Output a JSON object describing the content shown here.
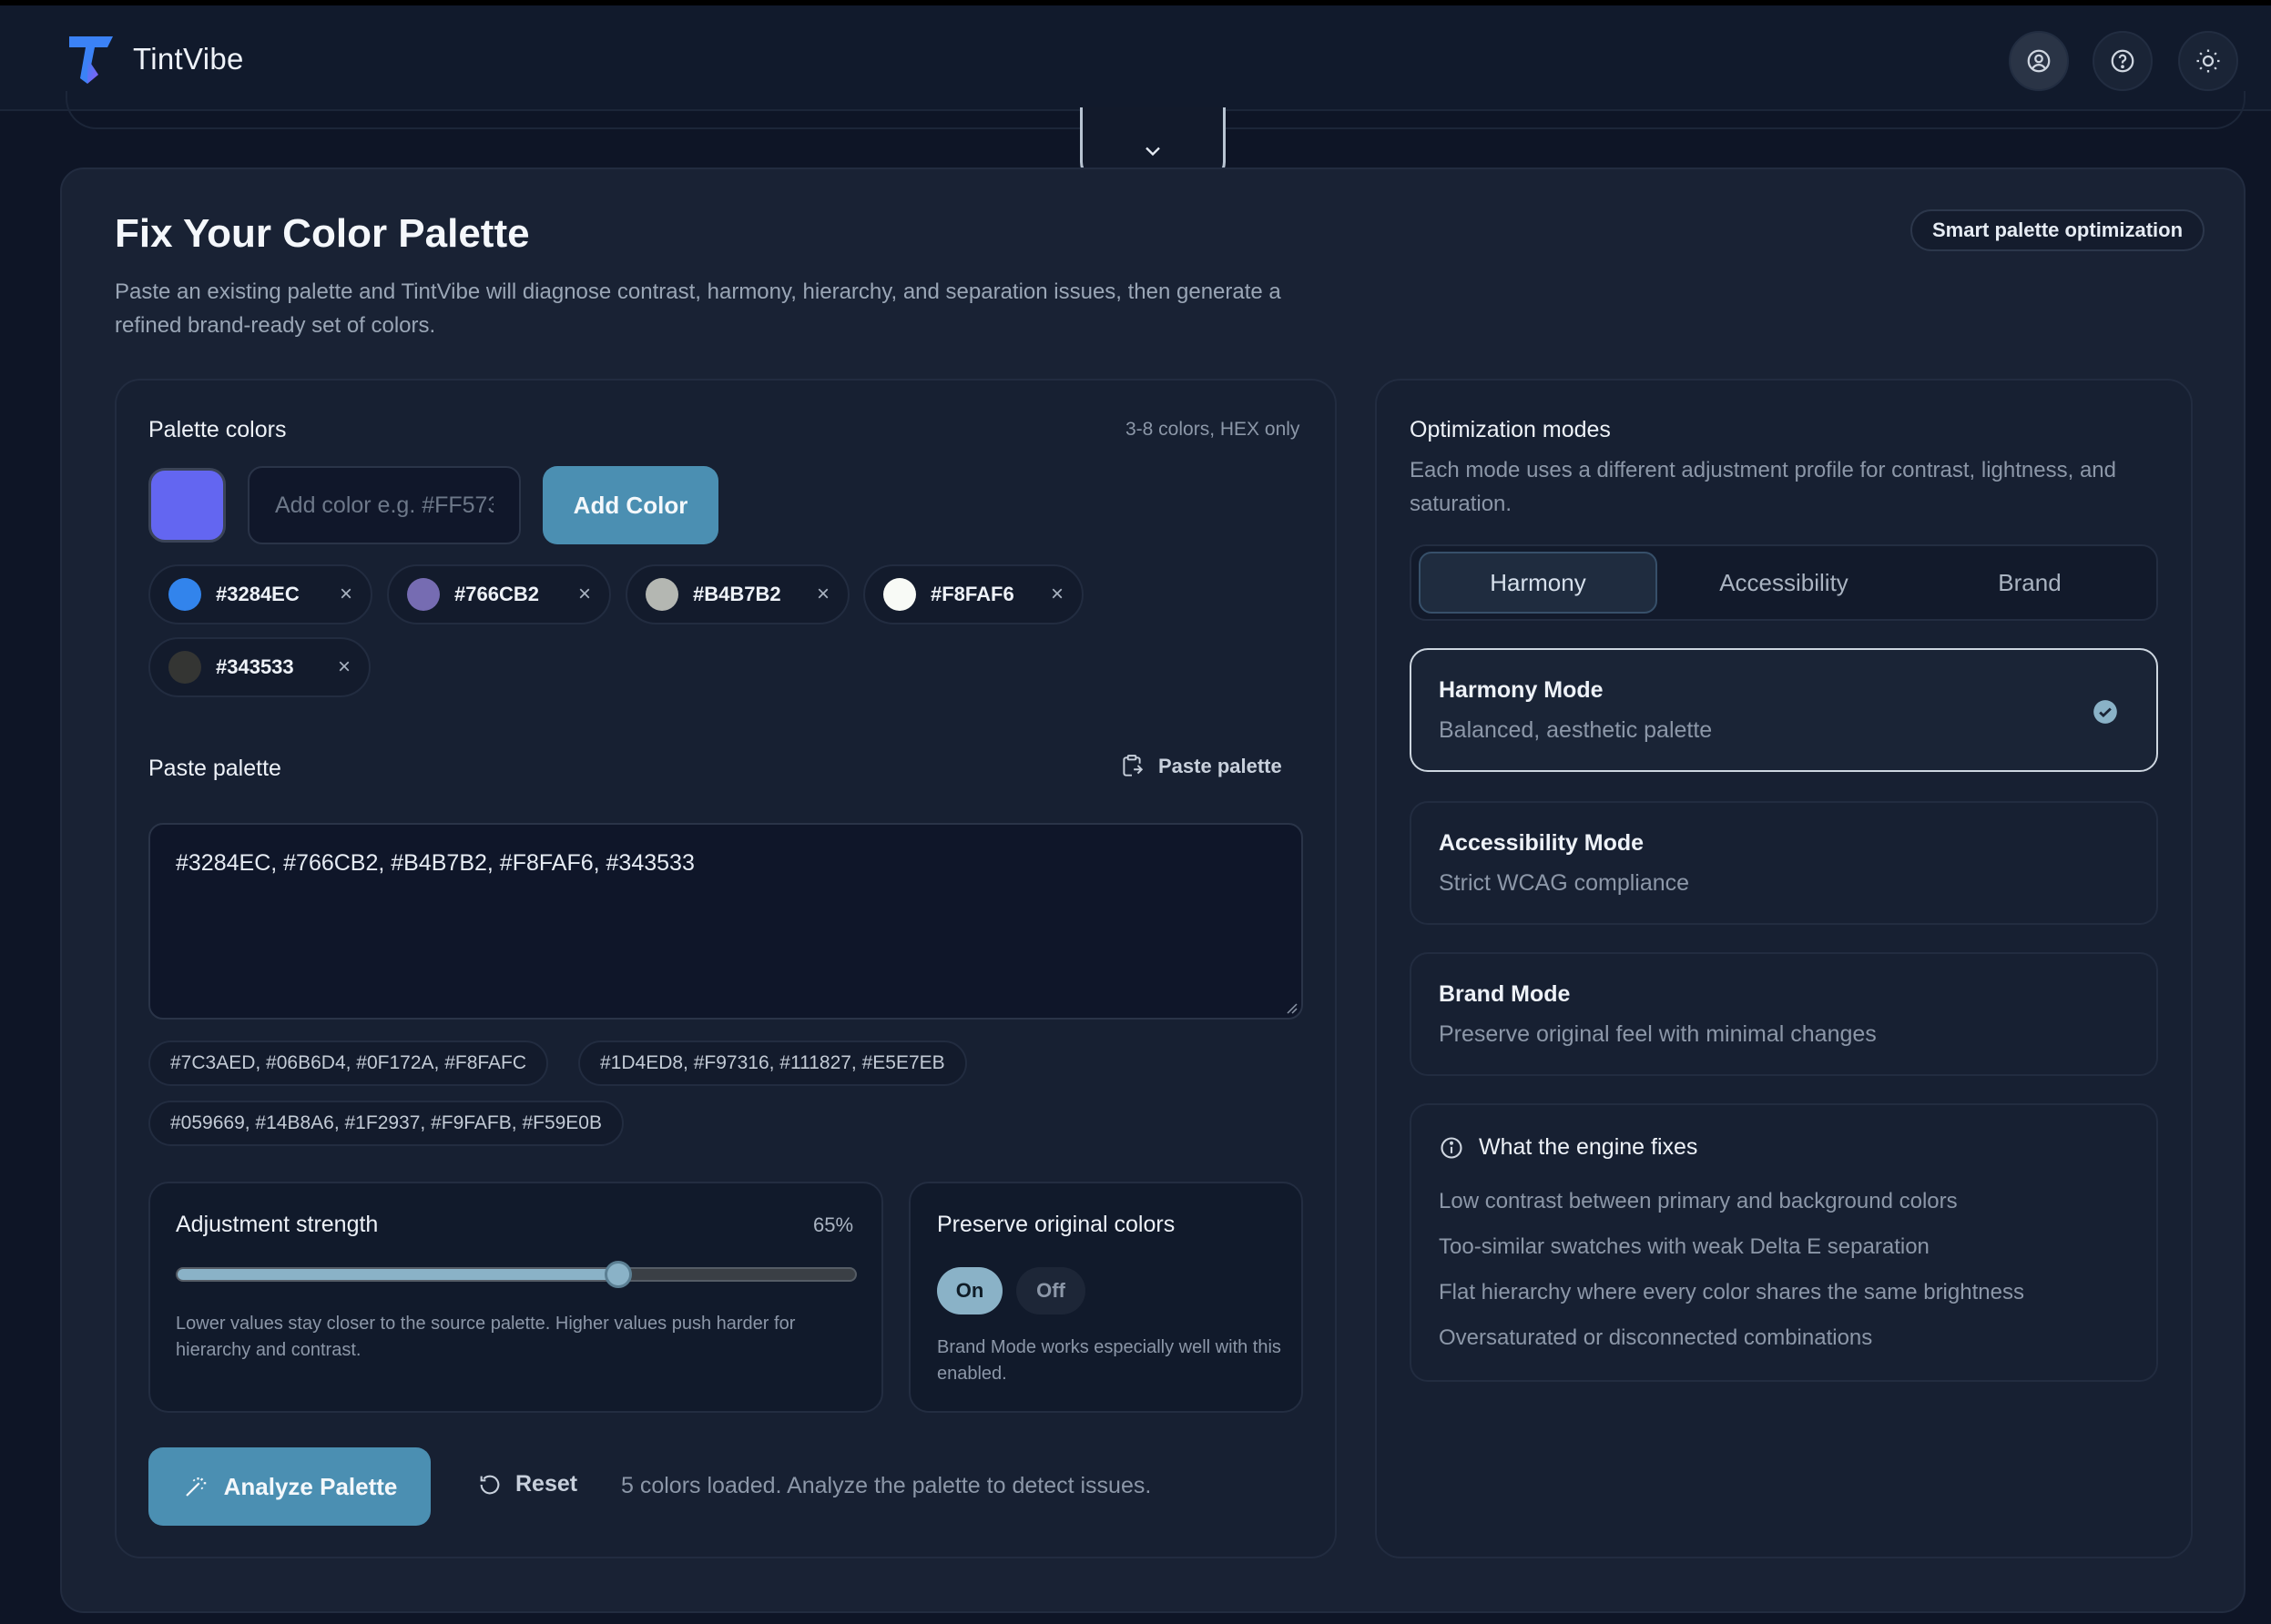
{
  "app": {
    "name": "TintVibe"
  },
  "header": {
    "icons": [
      "account-icon",
      "help-icon",
      "sun-icon"
    ]
  },
  "section": {
    "title": "Fix Your Color Palette",
    "subtitle": "Paste an existing palette and TintVibe will diagnose contrast, harmony, hierarchy, and separation issues, then generate a refined brand-ready set of colors.",
    "badge": "Smart palette optimization"
  },
  "palette": {
    "label": "Palette colors",
    "hint": "3-8 colors, HEX only",
    "current_swatch": "#6366F1",
    "input_placeholder": "Add color e.g. #FF573",
    "add_button": "Add Color",
    "chips": [
      {
        "hex": "#3284EC",
        "color": "#3284EC"
      },
      {
        "hex": "#766CB2",
        "color": "#766CB2"
      },
      {
        "hex": "#B4B7B2",
        "color": "#B4B7B2"
      },
      {
        "hex": "#F8FAF6",
        "color": "#F8FAF6"
      },
      {
        "hex": "#343533",
        "color": "#343533"
      }
    ],
    "remove_glyph": "×"
  },
  "paste": {
    "label": "Paste palette",
    "button": "Paste palette",
    "value": "#3284EC, #766CB2, #B4B7B2, #F8FAF6, #343533",
    "presets": [
      "#7C3AED, #06B6D4, #0F172A, #F8FAFC",
      "#1D4ED8, #F97316, #111827, #E5E7EB",
      "#059669, #14B8A6, #1F2937, #F9FAFB, #F59E0B"
    ]
  },
  "strength": {
    "label": "Adjustment strength",
    "value_text": "65%",
    "value": 0.65,
    "help": "Lower values stay closer to the source palette. Higher values push harder for hierarchy and contrast."
  },
  "preserve": {
    "label": "Preserve original colors",
    "on": "On",
    "off": "Off",
    "selected": "On",
    "note": "Brand Mode works especially well with this enabled."
  },
  "actions": {
    "analyze": "Analyze Palette",
    "reset": "Reset",
    "status": "5 colors loaded. Analyze the palette to detect issues."
  },
  "modes": {
    "title": "Optimization modes",
    "description": "Each mode uses a different adjustment profile for contrast, lightness, and saturation.",
    "tabs": [
      "Harmony",
      "Accessibility",
      "Brand"
    ],
    "active_tab": "Harmony",
    "cards": [
      {
        "name": "Harmony Mode",
        "desc": "Balanced, aesthetic palette",
        "selected": true
      },
      {
        "name": "Accessibility Mode",
        "desc": "Strict WCAG compliance",
        "selected": false
      },
      {
        "name": "Brand Mode",
        "desc": "Preserve original feel with minimal changes",
        "selected": false
      }
    ]
  },
  "engine": {
    "title": "What the engine fixes",
    "items": [
      "Low contrast between primary and background colors",
      "Too-similar swatches with weak Delta E separation",
      "Flat hierarchy where every color shares the same brightness",
      "Oversaturated or disconnected combinations"
    ]
  },
  "colors": {
    "accent": "#4B8FB2",
    "accent_light": "#8AB2C7",
    "background": "#0E1526",
    "card": "#192234"
  }
}
